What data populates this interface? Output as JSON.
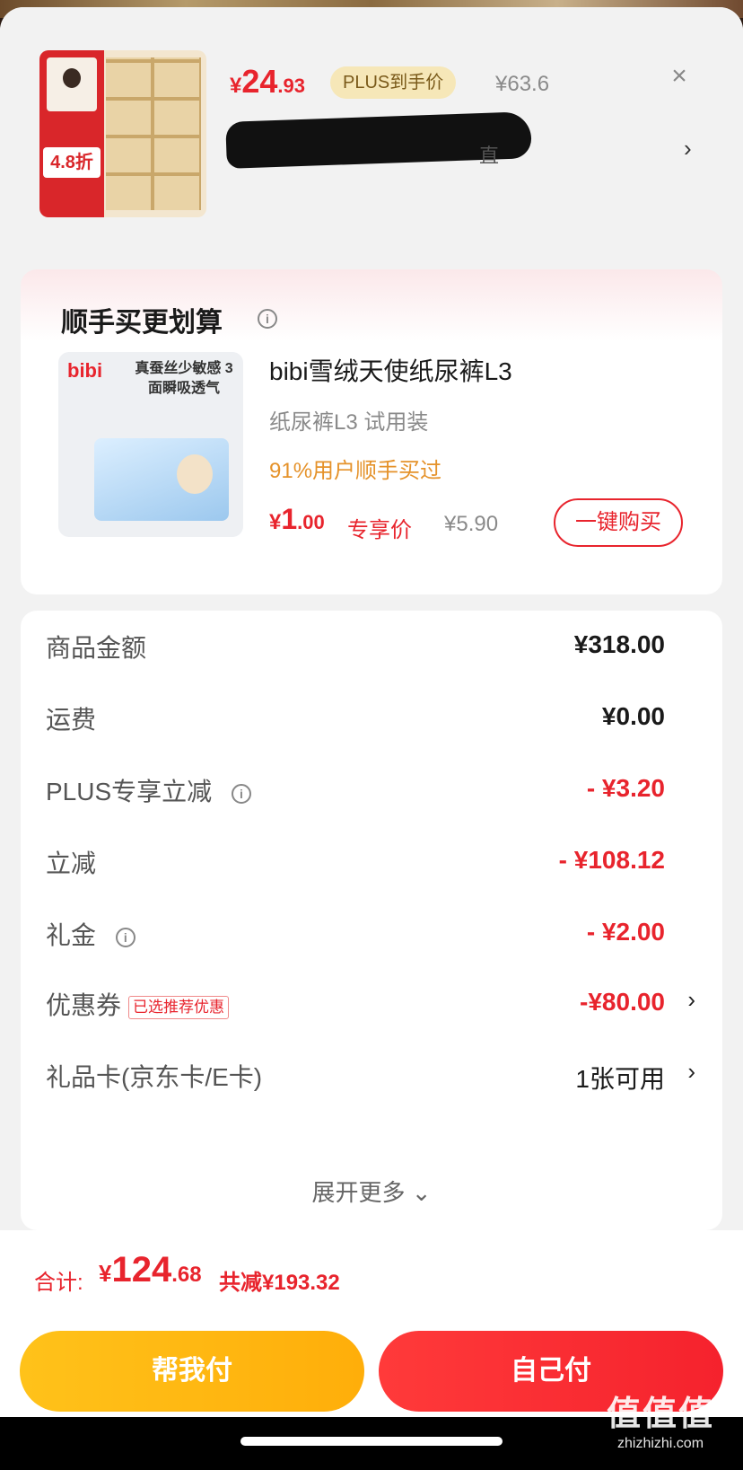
{
  "product": {
    "price_currency": "¥",
    "price_int": "24",
    "price_dec": ".93",
    "plus_tag": "PLUS到手价",
    "original_price": "¥63.6",
    "close_icon": "close-icon",
    "thumb_badge": "4.8折",
    "title_tail": "直"
  },
  "upsell": {
    "title": "顺手买更划算",
    "image_logo": "bibi",
    "image_text": "真蚕丝少敏感 3面瞬吸透气",
    "name": "bibi雪绒天使纸尿裤L3",
    "spec": "纸尿裤L3 试用装",
    "stat": "91%用户顺手买过",
    "price_currency": "¥",
    "price_int": "1",
    "price_dec": ".00",
    "price_tag": "专享价",
    "original_price": "¥5.90",
    "buy_label": "一键购买"
  },
  "summary": {
    "rows": [
      {
        "label": "商品金额",
        "value": "¥318.00"
      },
      {
        "label": "运费",
        "value": "¥0.00"
      },
      {
        "label": "PLUS专享立减",
        "value": "- ¥3.20"
      },
      {
        "label": "立减",
        "value": "- ¥108.12"
      },
      {
        "label": "礼金",
        "value": "- ¥2.00"
      },
      {
        "label": "优惠券",
        "tag": "已选推荐优惠",
        "value": "-¥80.00"
      },
      {
        "label": "礼品卡(京东卡/E卡)",
        "value": "1张可用"
      }
    ],
    "expand_more": "展开更多 ⌄"
  },
  "footer": {
    "total_label": "合计:",
    "total_currency": "¥",
    "total_int": "124",
    "total_dec": ".68",
    "total_saved": "共减¥193.32",
    "help_pay": "帮我付",
    "self_pay": "自己付"
  },
  "watermark": {
    "main": "值值值",
    "sub": "zhizhizhi.com"
  },
  "colors": {
    "accent": "#e8242d",
    "help_button": "#ffb814",
    "plus_tag_bg": "#f6e7b8",
    "coupon_orange": "#e5922a"
  }
}
